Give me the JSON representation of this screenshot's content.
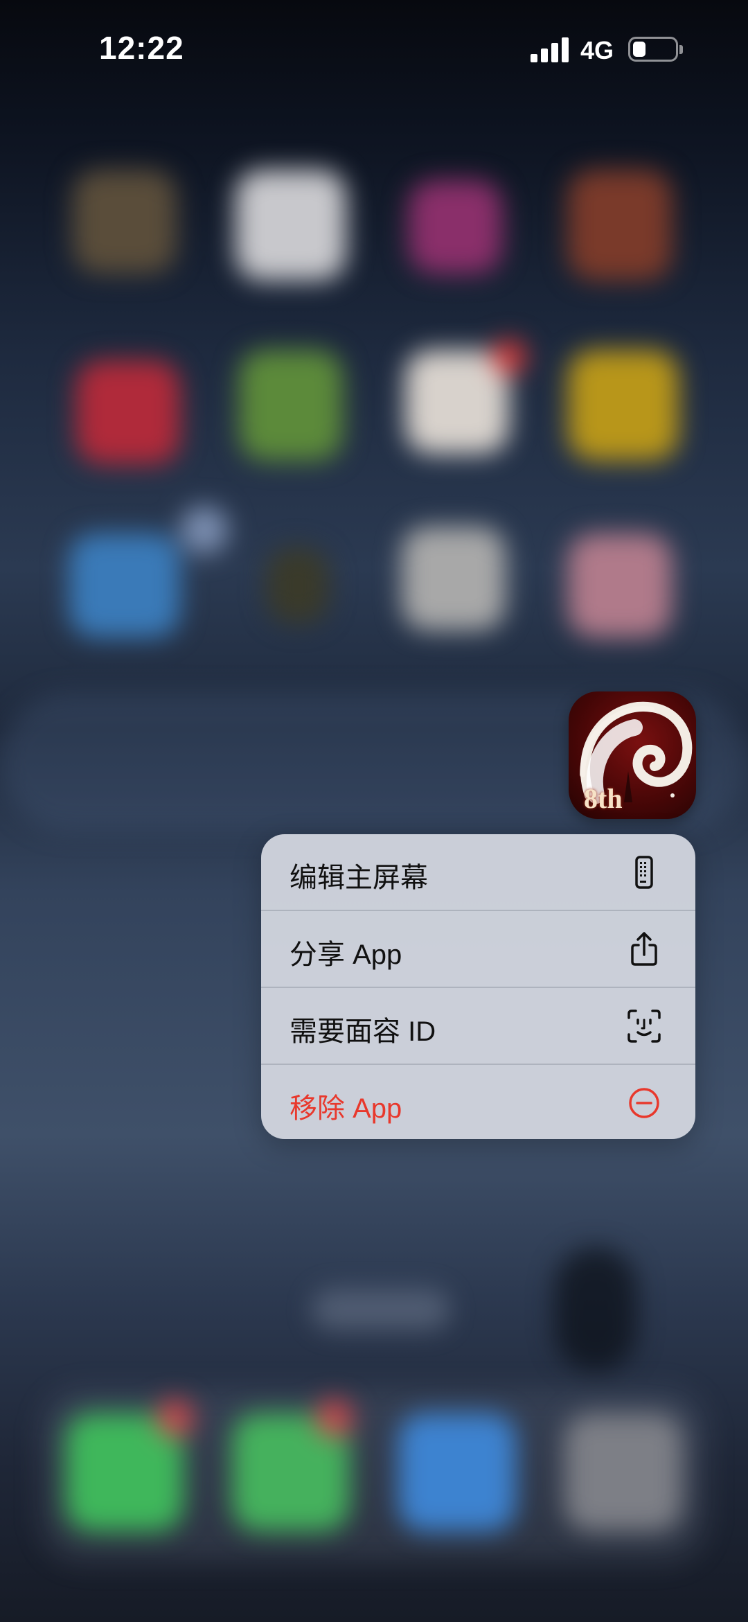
{
  "status_bar": {
    "time": "12:22",
    "network": "4G"
  },
  "focused_app": {
    "badge_text": "8th",
    "icon": "game-app-icon"
  },
  "context_menu": {
    "items": [
      {
        "label": "编辑主屏幕",
        "icon": "phone-screen-icon",
        "style": "normal"
      },
      {
        "label": "分享 App",
        "icon": "share-icon",
        "style": "normal"
      },
      {
        "label": "需要面容 ID",
        "icon": "face-id-icon",
        "style": "normal"
      },
      {
        "label": "移除 App",
        "icon": "minus-circle-icon",
        "style": "destructive"
      }
    ]
  },
  "colors": {
    "destructive": "#e8382c",
    "menu_background": "#d6d9e2",
    "text_primary": "#111111"
  }
}
